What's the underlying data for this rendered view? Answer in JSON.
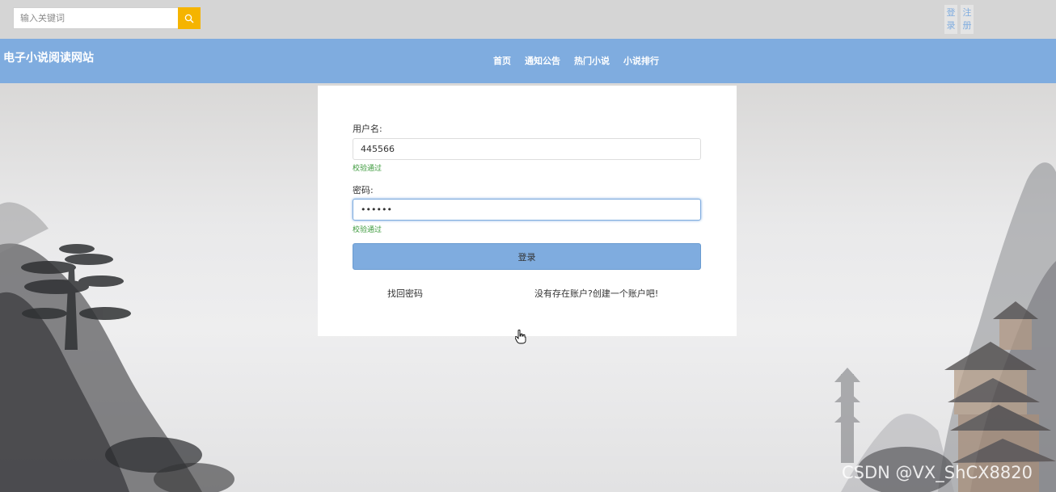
{
  "search": {
    "placeholder": "输入关键词"
  },
  "auth": {
    "login": "登 录",
    "register": "注 册"
  },
  "header": {
    "site_title": "电子小说阅读网站",
    "nav": [
      "首页",
      "通知公告",
      "热门小说",
      "小说排行"
    ]
  },
  "login_form": {
    "username_label": "用户名:",
    "username_value": "445566",
    "username_valid": "校验通过",
    "password_label": "密码:",
    "password_value": "••••••",
    "password_valid": "校验通过",
    "submit_label": "登录",
    "forgot_link": "找回密码",
    "register_link": "没有存在账户?创建一个账户吧!"
  },
  "watermark": "CSDN @VX_ShCX8820",
  "colors": {
    "accent": "#7facdf",
    "search_button": "#f5b400",
    "valid": "#3c9a3c"
  }
}
